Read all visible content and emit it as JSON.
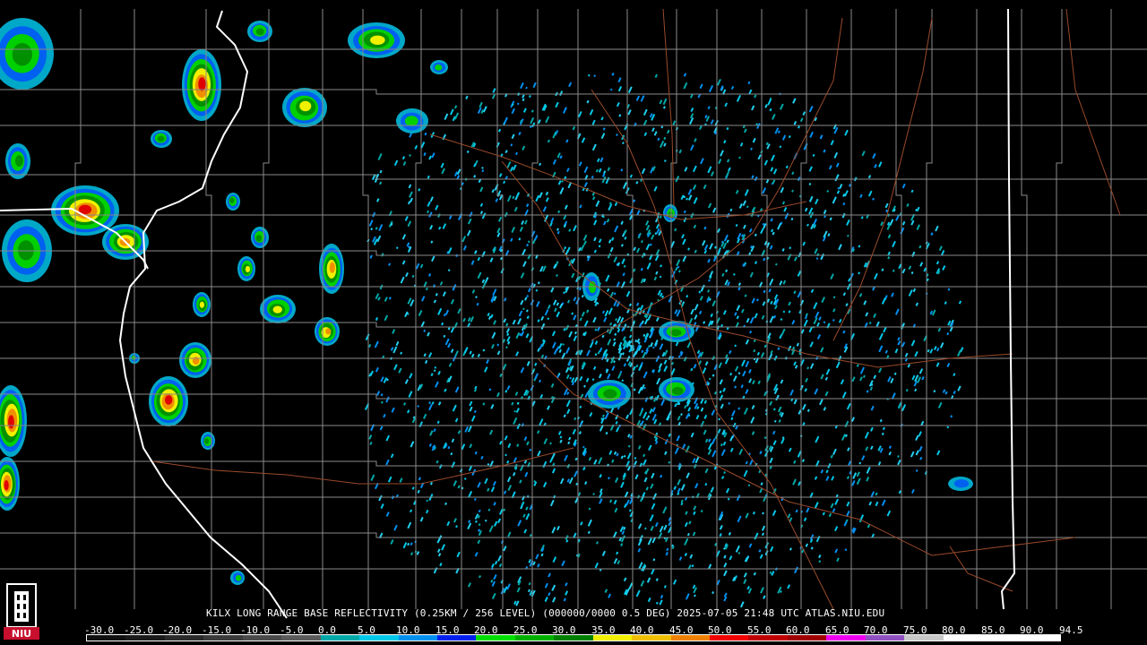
{
  "caption": "KILX LONG RANGE BASE REFLECTIVITY (0.25KM / 256 LEVEL) (000000/0000 0.5 DEG) 2025-07-05 21:48 UTC  ATLAS.NIU.EDU",
  "logo": {
    "text": "NIU",
    "icon": "niu-tower-logo-icon",
    "color": "#c8102e"
  },
  "colors": {
    "background": "#000000",
    "county_lines": "#8a8a8a",
    "state_lines": "#ffffff",
    "roads": "#9a4a2a",
    "rivers": "#ffffff"
  },
  "scale": {
    "labels": [
      "-30.0",
      "-25.0",
      "-20.0",
      "-15.0",
      "-10.0",
      "-5.0",
      "0.0",
      "5.0",
      "10.0",
      "15.0",
      "20.0",
      "25.0",
      "30.0",
      "35.0",
      "40.0",
      "45.0",
      "50.0",
      "55.0",
      "60.0",
      "65.0",
      "70.0",
      "75.0",
      "80.0",
      "85.0",
      "90.0",
      "94.5"
    ],
    "colors": [
      "#101010",
      "#1a1a1a",
      "#2a2a2a",
      "#3a3a3a",
      "#4a4a4a",
      "#5a5a5a",
      "#00a8a8",
      "#00c8e8",
      "#0090f0",
      "#0020f0",
      "#00e000",
      "#00b000",
      "#008000",
      "#f0f000",
      "#f0c000",
      "#f08000",
      "#f00000",
      "#c00000",
      "#a00000",
      "#f000f0",
      "#9050c0",
      "#c8c8c8",
      "#ffffff",
      "#ffffff",
      "#ffffff"
    ]
  }
}
